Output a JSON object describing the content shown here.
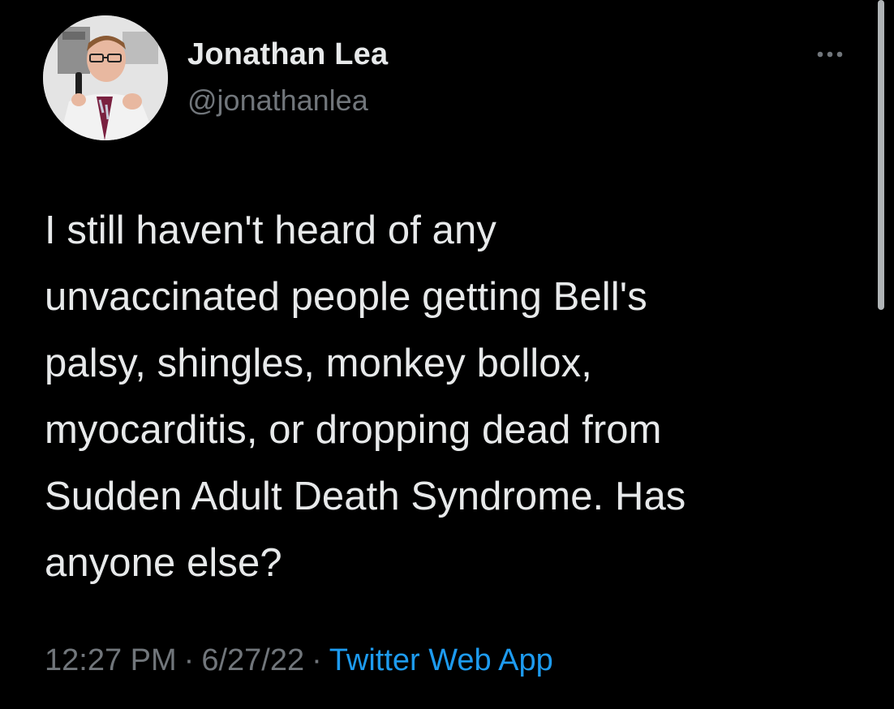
{
  "author": {
    "display_name": "Jonathan Lea",
    "handle": "@jonathanlea",
    "avatar_icon": "profile-photo"
  },
  "more_icon": "more-horizontal-icon",
  "tweet": {
    "text": "I still haven't heard of any\nunvaccinated people getting Bell's\npalsy, shingles, monkey bollox,\nmyocarditis, or dropping dead from\nSudden Adult Death Syndrome. Has\nanyone else?"
  },
  "meta": {
    "time": "12:27 PM",
    "separator": "·",
    "date": "6/27/22",
    "source": "Twitter Web App"
  },
  "colors": {
    "background": "#000000",
    "primary_text": "#e7e9ea",
    "secondary_text": "#71767b",
    "link": "#1d9bf0"
  }
}
